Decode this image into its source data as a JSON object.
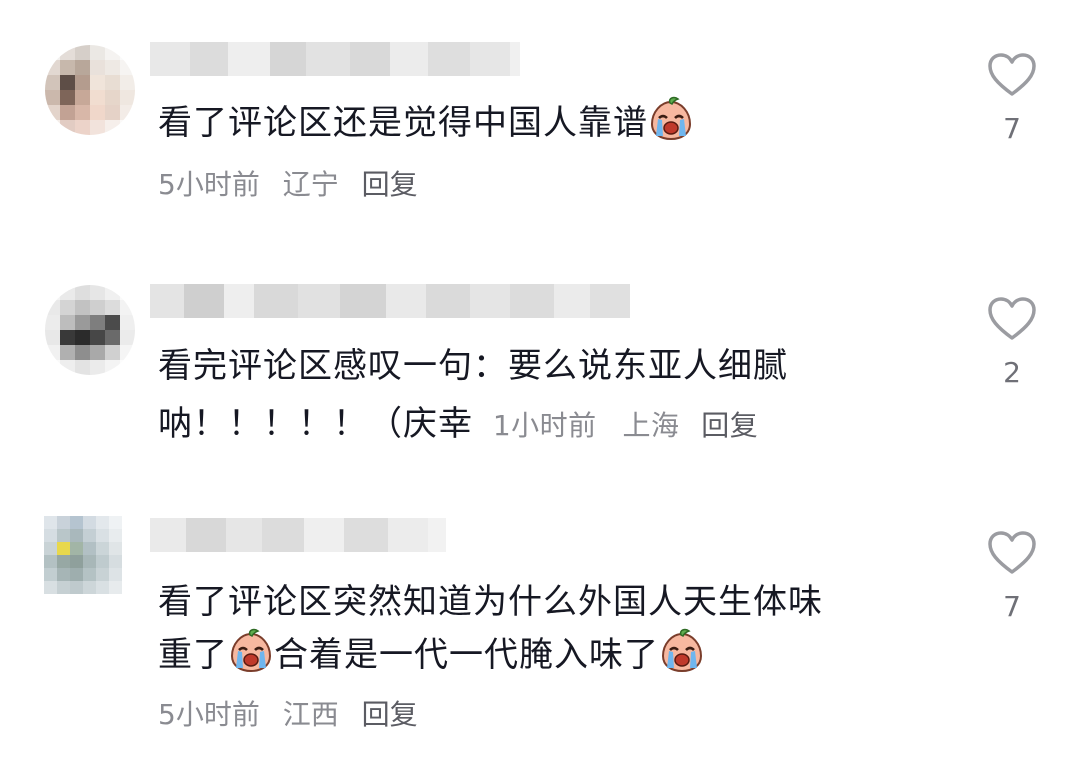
{
  "comments": [
    {
      "text": "看了评论区还是觉得中国人靠谱",
      "time": "5小时前",
      "location": "辽宁",
      "reply": "回复",
      "likes": "7"
    },
    {
      "text": "看完评论区感叹一句：要么说东亚人细腻呐！！！！！（庆幸",
      "text_line1": "看完评论区感叹一句：要么说东亚人细腻",
      "text_line2": "呐！！！！！（庆幸",
      "time": "1小时前",
      "location": "上海",
      "reply": "回复",
      "likes": "2"
    },
    {
      "text": "看了评论区突然知道为什么外国人天生体味重了[大哭]合着是一代一代腌入味了[大哭]",
      "text_line1": "看了评论区突然知道为什么外国人天生体味",
      "text_line2a": "重了",
      "text_line2b": "合着是一代一代腌入味了",
      "time": "5小时前",
      "location": "江西",
      "reply": "回复",
      "likes": "7"
    }
  ],
  "icons": {
    "like": "heart-outline-icon",
    "emoji": "crying-face-emoji-icon"
  },
  "colors": {
    "text": "#161823",
    "meta": "#8a8b91",
    "heart_stroke": "#9b9ca1"
  }
}
